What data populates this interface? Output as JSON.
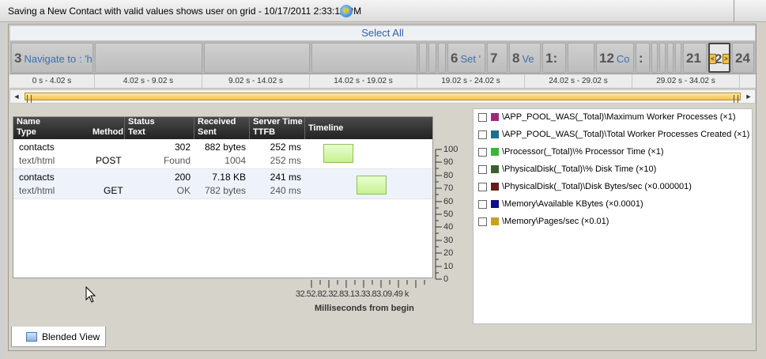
{
  "window": {
    "title": "Saving a New Contact with valid values shows user on grid - 10/17/2011 2:33:11 PM"
  },
  "select_all": "Select All",
  "thumbnails": [
    {
      "num": "3",
      "label": "Navigate to : 'h"
    },
    {
      "num": "6",
      "label": "Set '"
    },
    {
      "num": "7",
      "label": ""
    },
    {
      "num": "8",
      "label": "Ve"
    },
    {
      "num": "1:",
      "label": ""
    },
    {
      "num": "12",
      "label": "Co"
    },
    {
      "num": ":",
      "label": ""
    },
    {
      "num": "21",
      "label": ""
    },
    {
      "num": "2:",
      "label": ""
    },
    {
      "num": "24",
      "label": ""
    }
  ],
  "time_ranges": [
    "0 s - 4.02 s",
    "4.02 s - 9.02 s",
    "9.02 s - 14.02 s",
    "14.02 s - 19.02 s",
    "19.02 s - 24.02 s",
    "24.02 s - 29.02 s",
    "29.02 s - 34.02 s"
  ],
  "scroll": {
    "left_arrow": "◄",
    "right_arrow": "►"
  },
  "grid": {
    "headers": {
      "name": "Name",
      "type": "Type",
      "method": "Method",
      "status": "Status",
      "status_text": "Text",
      "received": "Received",
      "sent": "Sent",
      "server_time": "Server Time",
      "ttfb": "TTFB",
      "timeline": "Timeline"
    },
    "rows": [
      {
        "name": "contacts",
        "type": "text/html",
        "method": "POST",
        "status": "302",
        "status_text": "Found",
        "received": "882 bytes",
        "sent": "1004",
        "server_time": "252 ms",
        "ttfb": "252 ms"
      },
      {
        "name": "contacts",
        "type": "text/html",
        "method": "GET",
        "status": "200",
        "status_text": "OK",
        "received": "7.18 KB",
        "sent": "782 bytes",
        "server_time": "241 ms",
        "ttfb": "240 ms"
      }
    ]
  },
  "axis": {
    "y_ticks": [
      "100",
      "90",
      "80",
      "70",
      "60",
      "50",
      "40",
      "30",
      "20",
      "10",
      "0"
    ],
    "x_ticks_text": "32.52.82.32.83.13.33.83.09.49 k",
    "x_label": "Milliseconds from begin"
  },
  "legend": [
    {
      "label": "\\APP_POOL_WAS(_Total)\\Maximum Worker Processes (×1)",
      "color": "#a0287c"
    },
    {
      "label": "\\APP_POOL_WAS(_Total)\\Total Worker Processes Created (×1)",
      "color": "#1f6f8b"
    },
    {
      "label": "\\Processor(_Total)\\% Processor Time (×1)",
      "color": "#3ab53a"
    },
    {
      "label": "\\PhysicalDisk(_Total)\\% Disk Time (×10)",
      "color": "#3d5f2b"
    },
    {
      "label": "\\PhysicalDisk(_Total)\\Disk Bytes/sec (×0.000001)",
      "color": "#6b1a1a"
    },
    {
      "label": "\\Memory\\Available KBytes (×0.0001)",
      "color": "#10108c"
    },
    {
      "label": "\\Memory\\Pages/sec (×0.01)",
      "color": "#c9a01c"
    }
  ],
  "tab": {
    "label": "Blended View"
  }
}
